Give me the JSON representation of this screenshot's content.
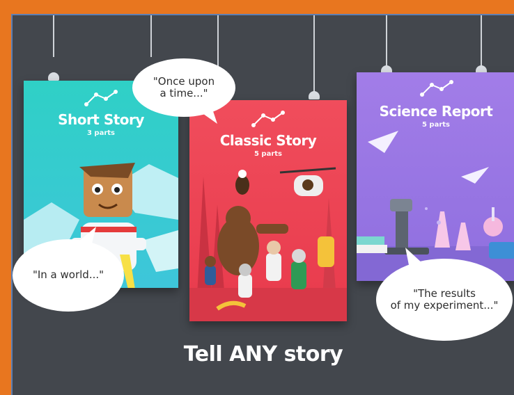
{
  "tagline": "Tell ANY story",
  "cards": {
    "short": {
      "title": "Short Story",
      "parts": "3 parts"
    },
    "classic": {
      "title": "Classic Story",
      "parts": "5 parts"
    },
    "science": {
      "title": "Science Report",
      "parts": "5 parts"
    }
  },
  "bubbles": {
    "once": "\"Once upon\na time...\"",
    "world": "\"In a world...\"",
    "results": "\"The results\nof my experiment...\""
  },
  "colors": {
    "background": "#43474d",
    "frame": "#e8761f",
    "short_card": "#2cc4c4",
    "classic_card": "#f0485a",
    "science_card": "#9b7be0"
  }
}
